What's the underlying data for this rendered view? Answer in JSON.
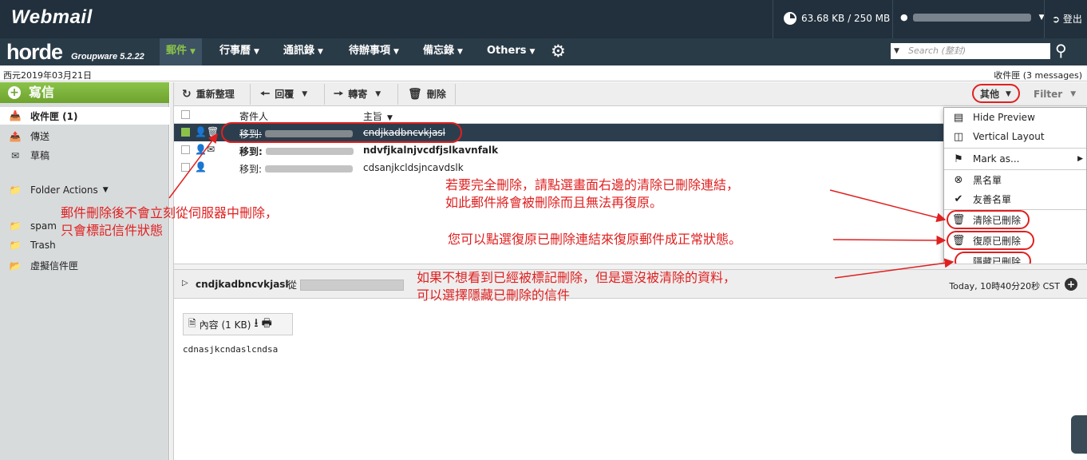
{
  "header": {
    "logo": "Webmail",
    "quota": "63.68 KB / 250 MB",
    "logout": "登出"
  },
  "nav": {
    "brand": "horde",
    "brand_sub": "Groupware 5.2.22",
    "items": [
      {
        "label": "郵件"
      },
      {
        "label": "行事曆"
      },
      {
        "label": "通訊錄"
      },
      {
        "label": "待辦事項"
      },
      {
        "label": "備忘錄"
      },
      {
        "label": "Others"
      }
    ],
    "search_placeholder": "Search (整封)"
  },
  "status": {
    "date": "西元2019年03月21日",
    "mailbox": "收件匣 (3 messages)"
  },
  "sidebar": {
    "compose": "寫信",
    "folders": [
      {
        "label": "收件匣 (1)",
        "icon": "inbox-icon"
      },
      {
        "label": "傳送",
        "icon": "outbox-icon"
      },
      {
        "label": "草稿",
        "icon": "drafts-icon"
      }
    ],
    "folder_actions": "Folder Actions",
    "extra": [
      {
        "label": "spam",
        "icon": "folder-icon"
      },
      {
        "label": "Trash",
        "icon": "folder-icon"
      },
      {
        "label": "虛擬信件匣",
        "icon": "virtual-folder-icon"
      }
    ]
  },
  "toolbar": {
    "refresh": "重新整理",
    "reply": "回覆",
    "forward": "轉寄",
    "delete": "刪除",
    "other": "其他",
    "filter": "Filter"
  },
  "list": {
    "col_from": "寄件人",
    "col_subject": "主旨",
    "rows": [
      {
        "from": "移到:",
        "subject": "cndjkadbncvkjasl"
      },
      {
        "from": "移到:",
        "subject": "ndvfjkalnjvcdfjslkavnfalk"
      },
      {
        "from": "移到:",
        "subject": "cdsanjkcldsjncavdslk"
      }
    ]
  },
  "menu": {
    "items": [
      {
        "label": "Hide Preview"
      },
      {
        "label": "Vertical Layout"
      },
      {
        "label": "Mark as..."
      },
      {
        "label": "黑名單"
      },
      {
        "label": "友善名單"
      },
      {
        "label": "清除已刪除"
      },
      {
        "label": "復原已刪除"
      },
      {
        "label": "隱藏已刪除"
      }
    ]
  },
  "preview": {
    "subject": "cndjkadbncvkjasl",
    "from_word": "從",
    "date": "Today, 10時40分20秒 CST",
    "attachment": "內容 (1 KB)",
    "body": "cdnasjkcndaslcndsa"
  },
  "annotations": {
    "a1_line1": "郵件刪除後不會立刻從伺服器中刪除，",
    "a1_line2": "只會標記信件狀態",
    "a2_line1": "若要完全刪除，請點選畫面右邊的清除已刪除連結，",
    "a2_line2": "如此郵件將會被刪除而且無法再復原。",
    "a3": "您可以點選復原已刪除連結來復原郵件成正常狀態。",
    "a4_line1": "如果不想看到已經被標記刪除，但是還沒被清除的資料，",
    "a4_line2": "可以選擇隱藏已刪除的信件"
  },
  "colors": {
    "accent": "#8bc34a",
    "header": "#21303c",
    "annotation": "#e02020"
  }
}
